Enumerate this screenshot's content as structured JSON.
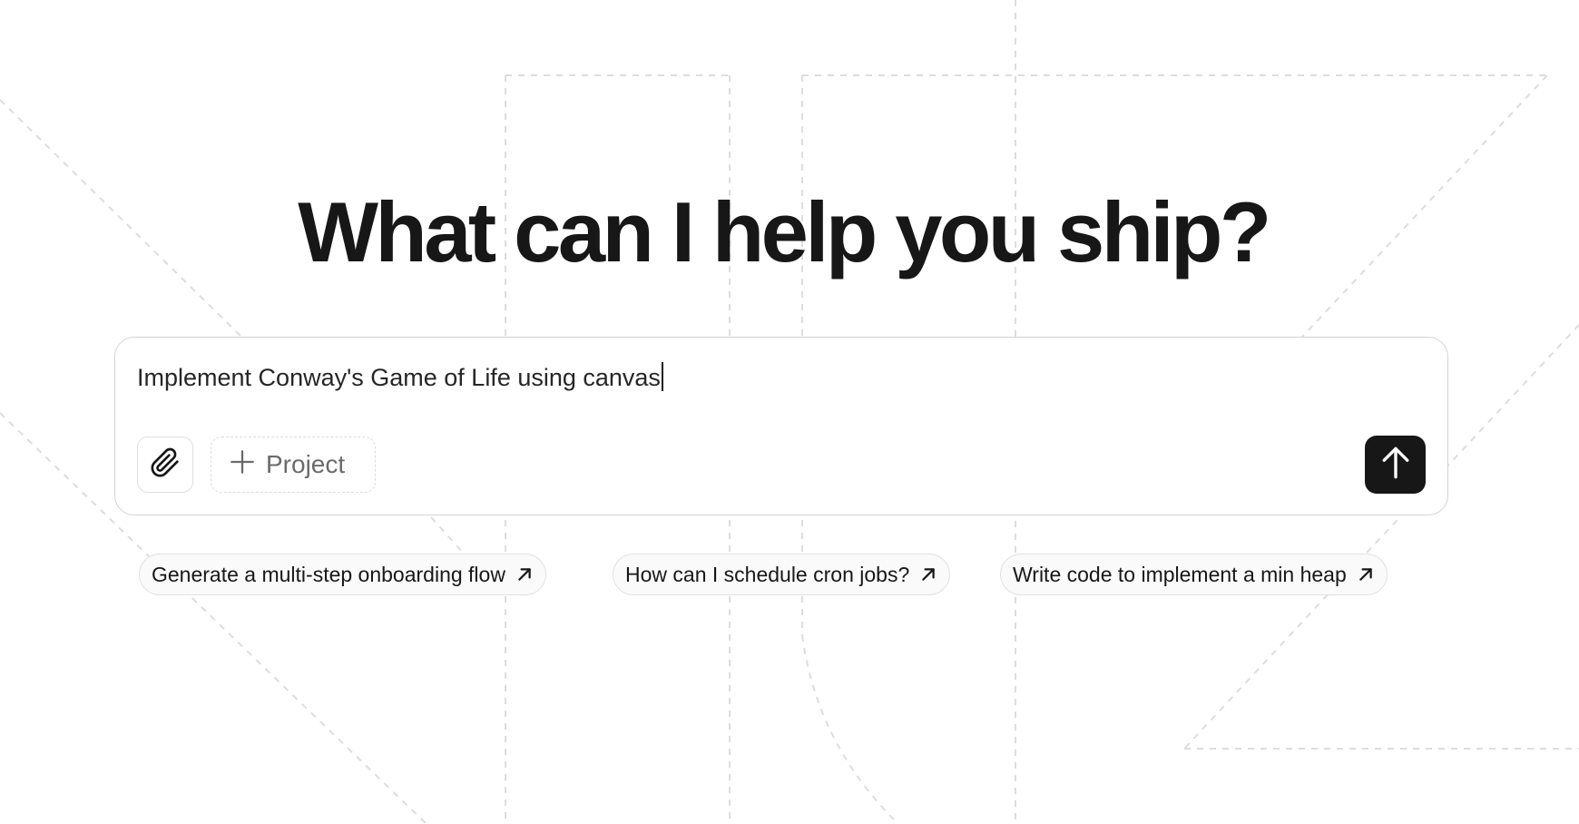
{
  "headline": "What can I help you ship?",
  "prompt": {
    "value": "Implement Conway's Game of Life using canvas",
    "attach_icon": "paperclip-icon",
    "project_label": "Project",
    "project_icon": "plus-icon",
    "send_icon": "arrow-up-icon"
  },
  "suggestions": [
    {
      "label": "Generate a multi-step onboarding flow",
      "icon": "arrow-up-right-icon"
    },
    {
      "label": "How can I schedule cron jobs?",
      "icon": "arrow-up-right-icon"
    },
    {
      "label": "Write code to implement a min heap",
      "icon": "arrow-up-right-icon"
    }
  ],
  "colors": {
    "text": "#171717",
    "send_button": "#171717",
    "border": "#d4d4d4",
    "chip_bg": "#fafafa",
    "bg_lines": "#dcdcdc"
  }
}
